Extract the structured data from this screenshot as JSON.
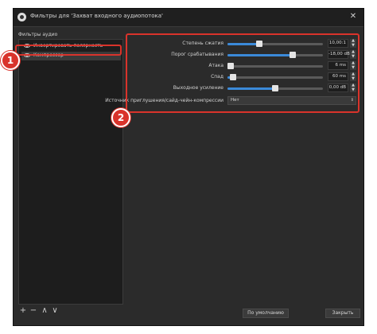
{
  "window": {
    "title": "Фильтры для 'Захват входного аудиопотока'",
    "close_symbol": "✕"
  },
  "sidebar": {
    "section_label": "Фильтры аудио",
    "items": [
      {
        "label": "Инвертировать полярность",
        "icon": "eye-icon",
        "selected": false
      },
      {
        "label": "Компрессор",
        "icon": "eye-icon",
        "selected": true
      }
    ],
    "tools": [
      "+",
      "−",
      "∧",
      "∨"
    ]
  },
  "properties": {
    "rows": [
      {
        "label": "Степень сжатия",
        "value": "10,00:1",
        "fraction": 0.33
      },
      {
        "label": "Порог срабатывания",
        "value": "-18,00 dB",
        "fraction": 0.68
      },
      {
        "label": "Атака",
        "value": "6 ms",
        "fraction": 0.03
      },
      {
        "label": "Спад",
        "value": "60 ms",
        "fraction": 0.06
      },
      {
        "label": "Выходное усиление",
        "value": "0,00 dB",
        "fraction": 0.5
      }
    ],
    "sidechain": {
      "label": "Источник приглушения/сайд-чейн-компрессии",
      "value": "Нет"
    }
  },
  "buttons": {
    "defaults": "По умолчанию",
    "close": "Закрыть"
  },
  "annotations": {
    "badge1": "1",
    "badge2": "2",
    "color": "#d9332b"
  },
  "colors": {
    "accent": "#3b8ad9",
    "window_bg": "#2b2b2b",
    "highlight": "#d9332b"
  }
}
